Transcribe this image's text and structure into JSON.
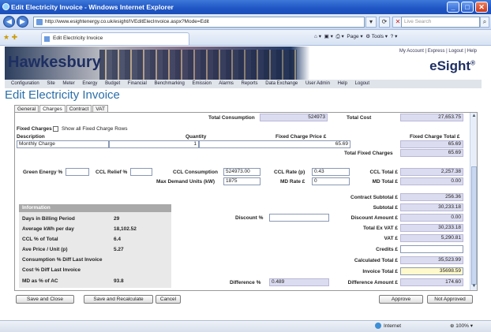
{
  "window": {
    "title": "Edit Electricity Invoice - Windows Internet Explorer"
  },
  "browser": {
    "url": "http://www.esightenergy.co.uk/esight/IVEditElecInvoice.aspx?Mode=Edit",
    "search_placeholder": "Live Search",
    "tab_title": "Edit Electricity Invoice",
    "toolbar": {
      "page": "Page",
      "tools": "Tools"
    }
  },
  "header": {
    "logo": "Hawkesbury",
    "brand": "eSight",
    "brand_mark": "®",
    "links": [
      "My Account",
      "Express",
      "Logout",
      "Help"
    ]
  },
  "menu": [
    "Configuration",
    "Site",
    "Meter",
    "Energy",
    "Budget",
    "Financial",
    "Benchmarking",
    "Emission",
    "Alarms",
    "Reports",
    "Data Exchange",
    "User Admin",
    "Help",
    "Logout"
  ],
  "page_title": "Edit Electricity Invoice",
  "form_tabs": [
    "General",
    "Charges",
    "Contract",
    "VAT"
  ],
  "summary": {
    "total_consumption_label": "Total Consumption",
    "total_consumption": "524973",
    "total_cost_label": "Total Cost",
    "total_cost": "27,653.75"
  },
  "fixed_charges": {
    "heading": "Fixed Charges",
    "show_all_label": "Show all Fixed Charge Rows",
    "col_description": "Description",
    "col_quantity": "Quantity",
    "col_price": "Fixed Charge Price £",
    "col_total": "Fixed Charge Total £",
    "row": {
      "description": "Monthly Charge",
      "quantity": "1",
      "price": "65.69",
      "total": "65.69"
    },
    "total_label": "Total Fixed Charges",
    "total": "65.69"
  },
  "charges": {
    "green_energy_label": "Green Energy %",
    "green_energy": "",
    "ccl_relief_label": "CCL Relief %",
    "ccl_relief": "",
    "ccl_consumption_label": "CCL Consumption",
    "ccl_consumption": "524973.00",
    "ccl_rate_label": "CCL Rate (p)",
    "ccl_rate": "0.43",
    "ccl_total_label": "CCL Total £",
    "ccl_total": "2,257.38",
    "max_demand_label": "Max Demand Units (kW)",
    "max_demand": "1875",
    "md_rate_label": "MD Rate £",
    "md_rate": "0",
    "md_total_label": "MD Total £",
    "md_total": "0.00"
  },
  "totals": {
    "contract_subtotal_label": "Contract Subtotal £",
    "contract_subtotal": "256.36",
    "subtotal_label": "Subtotal £",
    "subtotal": "30,233.18",
    "discount_label": "Discount %",
    "discount": "",
    "discount_amount_label": "Discount Amount £",
    "discount_amount": "0.00",
    "total_ex_vat_label": "Total Ex VAT £",
    "total_ex_vat": "30,233.18",
    "vat_label": "VAT £",
    "vat": "5,290.81",
    "credits_label": "Credits £",
    "credits": "",
    "calculated_total_label": "Calculated Total £",
    "calculated_total": "35,523.99",
    "invoice_total_label": "Invoice Total £",
    "invoice_total": "35698.59",
    "difference_pct_label": "Difference %",
    "difference_pct": "0.489",
    "difference_amount_label": "Difference Amount £",
    "difference_amount": "174.60"
  },
  "information": {
    "heading": "Information",
    "rows": [
      {
        "label": "Days in Billing Period",
        "value": "29"
      },
      {
        "label": "Average kWh per day",
        "value": "18,102.52"
      },
      {
        "label": "CCL % of Total",
        "value": "6.4"
      },
      {
        "label": "Ave Price / Unit (p)",
        "value": "5.27"
      },
      {
        "label": "Consumption % Diff Last Invoice",
        "value": ""
      },
      {
        "label": "Cost % Diff Last Invoice",
        "value": ""
      },
      {
        "label": "MD as % of AC",
        "value": "93.8"
      }
    ]
  },
  "buttons": {
    "save_close": "Save and Close",
    "save_recalc": "Save and Recalculate",
    "cancel": "Cancel",
    "approve": "Approve",
    "not_approved": "Not Approved"
  },
  "status": {
    "zone": "Internet",
    "zoom": "100%"
  }
}
